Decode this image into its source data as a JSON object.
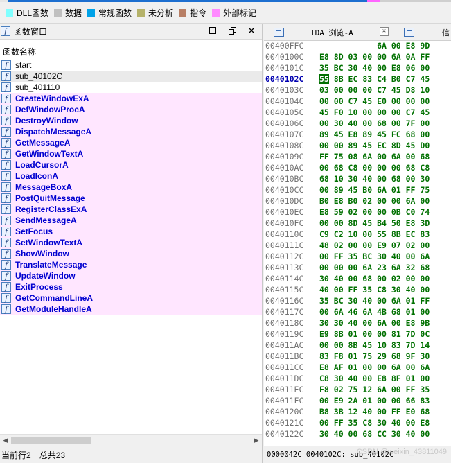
{
  "legend": [
    {
      "label": "DLL函数",
      "color": "#80ffff"
    },
    {
      "label": "数据",
      "color": "#c0c0c0"
    },
    {
      "label": "常规函数",
      "color": "#00a2e8"
    },
    {
      "label": "未分析",
      "color": "#b5b26a"
    },
    {
      "label": "指令",
      "color": "#b87f65"
    },
    {
      "label": "外部标记",
      "color": "#ff8aff"
    }
  ],
  "functions_window": {
    "title": "函数窗口",
    "column_header": "函数名称",
    "items": [
      {
        "name": "start",
        "kind": "plain"
      },
      {
        "name": "sub_40102C",
        "kind": "selected"
      },
      {
        "name": "sub_401110",
        "kind": "plain"
      },
      {
        "name": "CreateWindowExA",
        "kind": "lib"
      },
      {
        "name": "DefWindowProcA",
        "kind": "lib"
      },
      {
        "name": "DestroyWindow",
        "kind": "lib"
      },
      {
        "name": "DispatchMessageA",
        "kind": "lib"
      },
      {
        "name": "GetMessageA",
        "kind": "lib"
      },
      {
        "name": "GetWindowTextA",
        "kind": "lib"
      },
      {
        "name": "LoadCursorA",
        "kind": "lib"
      },
      {
        "name": "LoadIconA",
        "kind": "lib"
      },
      {
        "name": "MessageBoxA",
        "kind": "lib"
      },
      {
        "name": "PostQuitMessage",
        "kind": "lib"
      },
      {
        "name": "RegisterClassExA",
        "kind": "lib"
      },
      {
        "name": "SendMessageA",
        "kind": "lib"
      },
      {
        "name": "SetFocus",
        "kind": "lib"
      },
      {
        "name": "SetWindowTextA",
        "kind": "lib"
      },
      {
        "name": "ShowWindow",
        "kind": "lib"
      },
      {
        "name": "TranslateMessage",
        "kind": "lib"
      },
      {
        "name": "UpdateWindow",
        "kind": "lib"
      },
      {
        "name": "ExitProcess",
        "kind": "lib"
      },
      {
        "name": "GetCommandLineA",
        "kind": "lib"
      },
      {
        "name": "GetModuleHandleA",
        "kind": "lib"
      }
    ],
    "status_current_row": "当前行2",
    "status_total": "总共23"
  },
  "ida_view": {
    "tab_label": "IDA 浏览-A",
    "second_tab_label": "信",
    "lines": [
      {
        "addr": "00400FFC",
        "bytes": "            6A 00 E8 9D"
      },
      {
        "addr": "0040100C",
        "bytes": "E8 8D 03 00 00 6A 0A FF"
      },
      {
        "addr": "0040101C",
        "bytes": "35 BC 30 40 00 E8 06 00"
      },
      {
        "addr": "0040102C",
        "bytes": "55 8B EC 83 C4 B0 C7 45",
        "current": true,
        "hl": "55"
      },
      {
        "addr": "0040103C",
        "bytes": "03 00 00 00 C7 45 D8 10"
      },
      {
        "addr": "0040104C",
        "bytes": "00 00 C7 45 E0 00 00 00"
      },
      {
        "addr": "0040105C",
        "bytes": "45 F0 10 00 00 00 C7 45"
      },
      {
        "addr": "0040106C",
        "bytes": "00 30 40 00 68 00 7F 00"
      },
      {
        "addr": "0040107C",
        "bytes": "89 45 E8 89 45 FC 68 00"
      },
      {
        "addr": "0040108C",
        "bytes": "00 00 89 45 EC 8D 45 D0"
      },
      {
        "addr": "0040109C",
        "bytes": "FF 75 08 6A 00 6A 00 68"
      },
      {
        "addr": "004010AC",
        "bytes": "00 68 C8 00 00 00 68 C8"
      },
      {
        "addr": "004010BC",
        "bytes": "68 10 30 40 00 68 00 30"
      },
      {
        "addr": "004010CC",
        "bytes": "00 89 45 B0 6A 01 FF 75"
      },
      {
        "addr": "004010DC",
        "bytes": "B0 E8 B0 02 00 00 6A 00"
      },
      {
        "addr": "004010EC",
        "bytes": "E8 59 02 00 00 0B C0 74"
      },
      {
        "addr": "004010FC",
        "bytes": "00 00 8D 45 B4 50 E8 3D"
      },
      {
        "addr": "0040110C",
        "bytes": "C9 C2 10 00 55 8B EC 83"
      },
      {
        "addr": "0040111C",
        "bytes": "48 02 00 00 E9 07 02 00"
      },
      {
        "addr": "0040112C",
        "bytes": "00 FF 35 BC 30 40 00 6A"
      },
      {
        "addr": "0040113C",
        "bytes": "00 00 00 6A 23 6A 32 68"
      },
      {
        "addr": "0040114C",
        "bytes": "30 40 00 68 00 02 00 00"
      },
      {
        "addr": "0040115C",
        "bytes": "40 00 FF 35 C8 30 40 00"
      },
      {
        "addr": "0040116C",
        "bytes": "35 BC 30 40 00 6A 01 FF"
      },
      {
        "addr": "0040117C",
        "bytes": "00 6A 46 6A 4B 68 01 00"
      },
      {
        "addr": "0040118C",
        "bytes": "30 30 40 00 6A 00 E8 9B"
      },
      {
        "addr": "0040119C",
        "bytes": "E9 8B 01 00 00 81 7D 0C"
      },
      {
        "addr": "004011AC",
        "bytes": "00 00 8B 45 10 83 7D 14"
      },
      {
        "addr": "004011BC",
        "bytes": "83 F8 01 75 29 68 9F 30"
      },
      {
        "addr": "004011CC",
        "bytes": "E8 AF 01 00 00 6A 00 6A"
      },
      {
        "addr": "004011DC",
        "bytes": "C8 30 40 00 E8 8F 01 00"
      },
      {
        "addr": "004011EC",
        "bytes": "F8 02 75 12 6A 00 FF 35"
      },
      {
        "addr": "004011FC",
        "bytes": "00 E9 2A 01 00 00 66 83"
      },
      {
        "addr": "0040120C",
        "bytes": "B8 3B 12 40 00 FF E0 68"
      },
      {
        "addr": "0040121C",
        "bytes": "00 FF 35 C8 30 40 00 E8"
      },
      {
        "addr": "0040122C",
        "bytes": "30 40 00 68 CC 30 40 00"
      }
    ],
    "status": "0000042C 0040102C: sub_40102C",
    "watermark": "CSDN @weixin_43811049"
  }
}
